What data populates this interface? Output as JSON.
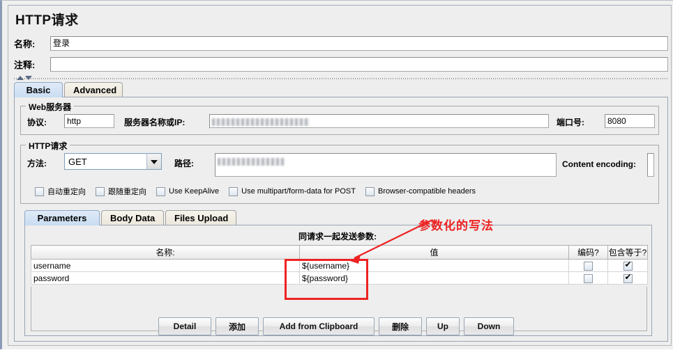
{
  "window": {
    "title": "HTTP请求"
  },
  "header": {
    "name_label": "名称:",
    "name_value": "登录",
    "comment_label": "注释:",
    "comment_value": ""
  },
  "main_tabs": [
    {
      "label": "Basic",
      "selected": true
    },
    {
      "label": "Advanced",
      "selected": false
    }
  ],
  "web_server": {
    "legend": "Web服务器",
    "protocol_label": "协议:",
    "protocol_value": "http",
    "server_label": "服务器名称或IP:",
    "server_value": "",
    "server_redacted": true,
    "port_label": "端口号:",
    "port_value": "8080"
  },
  "http_request": {
    "legend": "HTTP请求",
    "method_label": "方法:",
    "method_value": "GET",
    "path_label": "路径:",
    "path_value": "",
    "path_redacted": true,
    "content_encoding_label": "Content encoding:",
    "content_encoding_value": ""
  },
  "options": [
    {
      "label": "自动重定向",
      "checked": false
    },
    {
      "label": "跟随重定向",
      "checked": false
    },
    {
      "label": "Use KeepAlive",
      "checked": false
    },
    {
      "label": "Use multipart/form-data for POST",
      "checked": false
    },
    {
      "label": "Browser-compatible headers",
      "checked": false
    }
  ],
  "param_tabs": [
    {
      "label": "Parameters",
      "selected": true
    },
    {
      "label": "Body Data",
      "selected": false
    },
    {
      "label": "Files Upload",
      "selected": false
    }
  ],
  "params_table": {
    "caption": "同请求一起发送参数:",
    "columns": [
      "名称:",
      "值",
      "编码?",
      "包含等于?"
    ],
    "rows": [
      {
        "name": "username",
        "value": "${username}",
        "encode": false,
        "include_equals": true
      },
      {
        "name": "password",
        "value": "${password}",
        "encode": false,
        "include_equals": true
      }
    ]
  },
  "buttons": [
    {
      "label": "Detail"
    },
    {
      "label": "添加"
    },
    {
      "label": "Add from Clipboard"
    },
    {
      "label": "删除"
    },
    {
      "label": "Up"
    },
    {
      "label": "Down"
    }
  ],
  "annotation": {
    "text": "参数化的写法",
    "color": "#ee2222"
  }
}
